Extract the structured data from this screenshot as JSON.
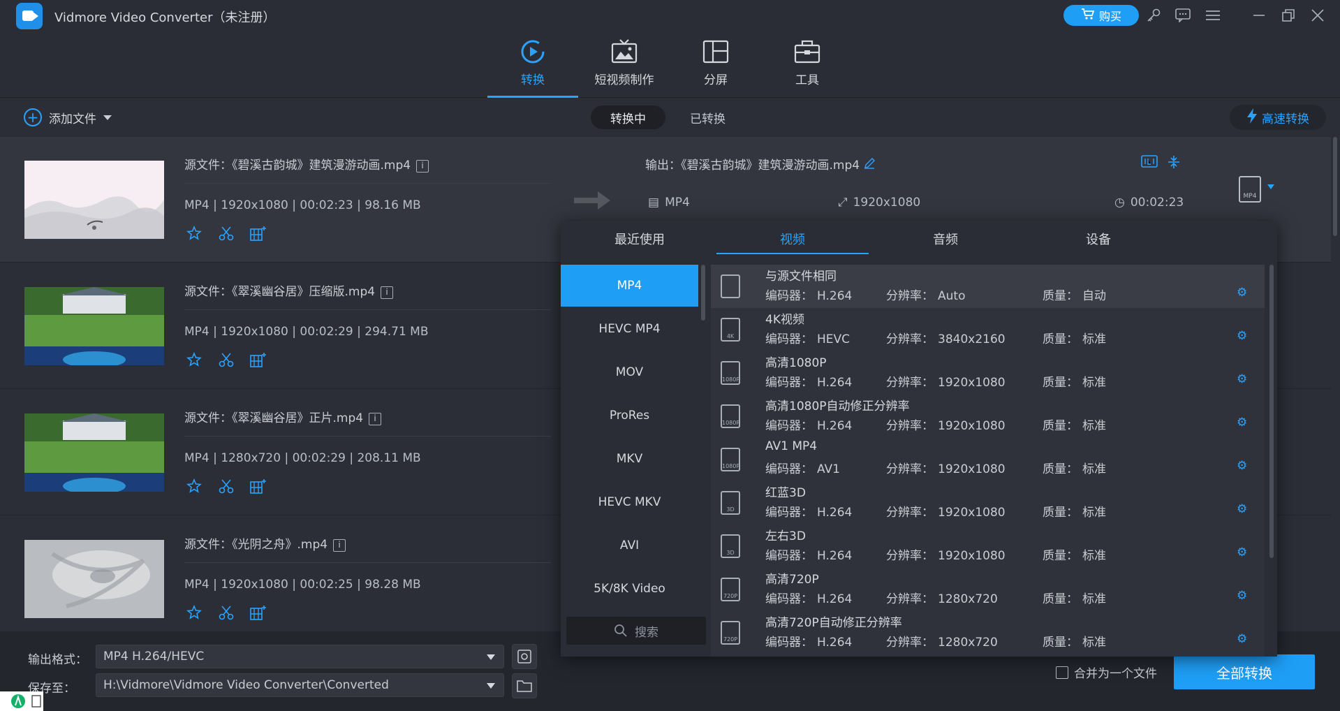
{
  "app": {
    "title": "Vidmore Video Converter（未注册）",
    "buy_label": "购买"
  },
  "nav": [
    {
      "label": "转换",
      "icon": "convert-icon",
      "active": true
    },
    {
      "label": "短视频制作",
      "icon": "mv-icon"
    },
    {
      "label": "分屏",
      "icon": "collage-icon"
    },
    {
      "label": "工具",
      "icon": "toolbox-icon"
    }
  ],
  "subbar": {
    "add_file": "添加文件",
    "tab_converting": "转换中",
    "tab_converted": "已转换",
    "fast_convert": "高速转换"
  },
  "files": [
    {
      "source": "源文件：《碧溪古韵城》建筑漫游动画.mp4",
      "meta": "MP4 | 1920x1080 | 00:02:23 | 98.16 MB",
      "output": "输出：《碧溪古韵城》建筑漫游动画.mp4",
      "out_format": "MP4",
      "out_res": "1920x1080",
      "out_dur": "00:02:23",
      "badge": "MP4"
    },
    {
      "source": "源文件：《翠溪幽谷居》压缩版.mp4",
      "meta": "MP4 | 1920x1080 | 00:02:29 | 294.71 MB"
    },
    {
      "source": "源文件：《翠溪幽谷居》正片.mp4",
      "meta": "MP4 | 1280x720 | 00:02:29 | 208.11 MB"
    },
    {
      "source": "源文件：《光阴之舟》.mp4",
      "meta": "MP4 | 1920x1080 | 00:02:25 | 98.28 MB"
    }
  ],
  "popup": {
    "tabs": [
      "最近使用",
      "视频",
      "音频",
      "设备"
    ],
    "active_tab": 1,
    "categories": [
      "MP4",
      "HEVC MP4",
      "MOV",
      "ProRes",
      "MKV",
      "HEVC MKV",
      "AVI",
      "5K/8K Video"
    ],
    "search_placeholder": "搜索",
    "labels": {
      "codec": "编码器：",
      "res": "分辨率：",
      "quality": "质量："
    },
    "presets": [
      {
        "name": "与源文件相同",
        "codec": "H.264",
        "res": "Auto",
        "quality": "自动",
        "badge": ""
      },
      {
        "name": "4K视频",
        "codec": "HEVC",
        "res": "3840x2160",
        "quality": "标准",
        "badge": "4K"
      },
      {
        "name": "高清1080P",
        "codec": "H.264",
        "res": "1920x1080",
        "quality": "标准",
        "badge": "1080P"
      },
      {
        "name": "高清1080P自动修正分辨率",
        "codec": "H.264",
        "res": "1920x1080",
        "quality": "标准",
        "badge": "1080P"
      },
      {
        "name": "AV1 MP4",
        "codec": "AV1",
        "res": "1920x1080",
        "quality": "标准",
        "badge": "1080P"
      },
      {
        "name": "红蓝3D",
        "codec": "H.264",
        "res": "1920x1080",
        "quality": "标准",
        "badge": "3D"
      },
      {
        "name": "左右3D",
        "codec": "H.264",
        "res": "1920x1080",
        "quality": "标准",
        "badge": "3D"
      },
      {
        "name": "高清720P",
        "codec": "H.264",
        "res": "1280x720",
        "quality": "标准",
        "badge": "720P"
      },
      {
        "name": "高清720P自动修正分辨率",
        "codec": "H.264",
        "res": "1280x720",
        "quality": "标准",
        "badge": "720P"
      }
    ]
  },
  "bottom": {
    "format_label": "输出格式：",
    "format_value": "MP4 H.264/HEVC",
    "save_label": "保存至：",
    "save_value": "H:\\Vidmore\\Vidmore Video Converter\\Converted",
    "merge_label": "合并为一个文件",
    "convert_all": "全部转换"
  },
  "colors": {
    "accent": "#1e9ef5",
    "bg": "#2b2e37"
  }
}
